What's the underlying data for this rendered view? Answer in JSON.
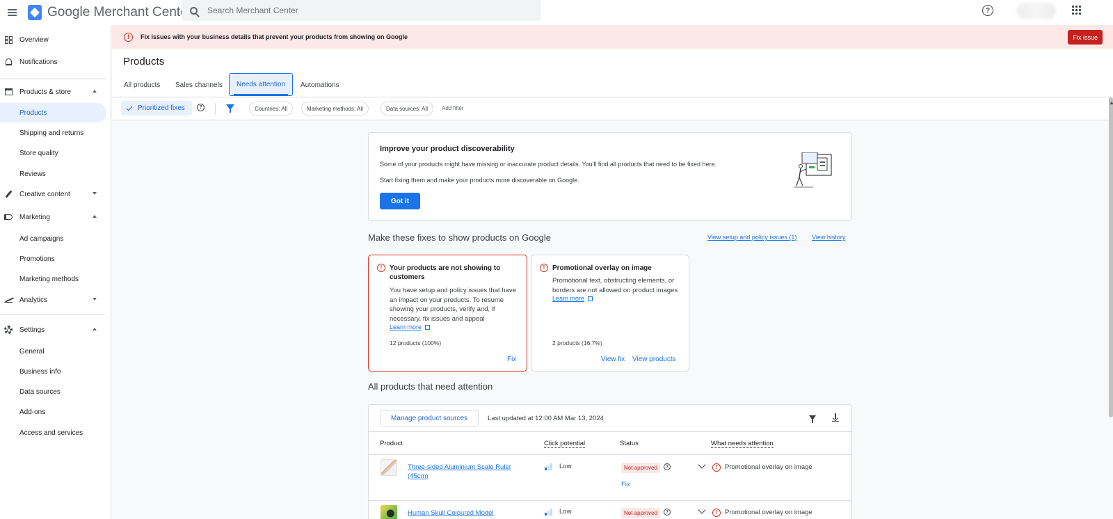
{
  "topbar": {
    "app_title": "Google Merchant Center",
    "search_placeholder": "Search Merchant Center"
  },
  "sidebar": {
    "items": [
      {
        "label": "Overview",
        "icon": "dashboard-icon"
      },
      {
        "label": "Notifications",
        "icon": "bell-icon"
      },
      {
        "label": "Products & store",
        "icon": "store-icon",
        "expanded": true
      },
      {
        "label": "Products",
        "active": true
      },
      {
        "label": "Shipping and returns"
      },
      {
        "label": "Store quality"
      },
      {
        "label": "Reviews"
      },
      {
        "label": "Creative content",
        "icon": "brush-icon",
        "expanded": false
      },
      {
        "label": "Marketing",
        "icon": "megaphone-icon",
        "expanded": true
      },
      {
        "label": "Ad campaigns"
      },
      {
        "label": "Promotions"
      },
      {
        "label": "Marketing methods"
      },
      {
        "label": "Analytics",
        "icon": "trending-icon",
        "expanded": false
      },
      {
        "label": "Settings",
        "icon": "gear-icon",
        "expanded": true
      },
      {
        "label": "General"
      },
      {
        "label": "Business info"
      },
      {
        "label": "Data sources"
      },
      {
        "label": "Add-ons"
      },
      {
        "label": "Access and services"
      }
    ]
  },
  "banner": {
    "text": "Fix issues with your business details that prevent your products from showing on Google",
    "button": "Fix issue"
  },
  "page": {
    "title": "Products",
    "tabs": [
      "All products",
      "Sales channels",
      "Needs attention",
      "Automations"
    ],
    "active_tab": "Needs attention"
  },
  "filters": {
    "prioritized": "Prioritized fixes",
    "chips": [
      "Countries: All",
      "Marketing methods: All",
      "Data sources: All"
    ],
    "add_filter": "Add filter"
  },
  "discover": {
    "title": "Improve your product discoverability",
    "line1": "Some of your products might have missing or inaccurate product details. You'll find all products that need to be fixed here.",
    "line2": "Start fixing them and make your products more discoverable on Google.",
    "button": "Got it"
  },
  "fixes": {
    "heading": "Make these fixes to show products on Google",
    "link_setup": "View setup and policy issues (1)",
    "link_history": "View history",
    "cards": [
      {
        "title": "Your products are not showing to customers",
        "desc": "You have setup and policy issues that have an impact on your products. To resume showing your products, verify and, if necessary, fix issues and appeal",
        "learn": "Learn more",
        "count": "12 products (100%)",
        "action1": "Fix"
      },
      {
        "title": "Promotional overlay on image",
        "desc": "Promotional text, obstructing elements, or borders are not allowed on product images",
        "learn": "Learn more",
        "count": "2 products (16.7%)",
        "action1": "View fix",
        "action2": "View products"
      }
    ]
  },
  "table": {
    "heading": "All products that need attention",
    "manage_button": "Manage product sources",
    "last_updated": "Last updated at 12:00 AM Mar 13, 2024",
    "columns": [
      "Product",
      "Click potential",
      "Status",
      "What needs attention"
    ],
    "rows": [
      {
        "product": "Three-sided Aluminium Scale Ruler (45cm)",
        "click": "Low",
        "click_level": 1,
        "status": "Not approved",
        "fix": "Fix",
        "attention": "Promotional overlay on image"
      },
      {
        "product": "Human Skull Coloured Model",
        "click": "Low",
        "click_level": 1,
        "status": "Not approved",
        "attention": "Promotional overlay on image"
      }
    ]
  },
  "colors": {
    "primary": "#1a73e8",
    "error": "#d93025",
    "banner_bg": "#fce8e6",
    "active_nav_bg": "#e8f0fe"
  }
}
